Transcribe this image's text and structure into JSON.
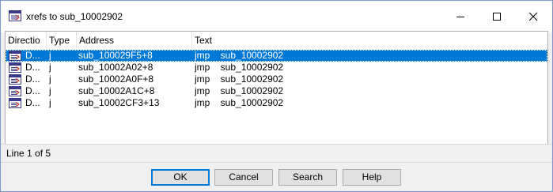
{
  "window": {
    "title": "xrefs to sub_10002902",
    "accent_color": "#0078d7"
  },
  "listview": {
    "columns": [
      "Directio",
      "Type",
      "Address",
      "Text"
    ],
    "rows": [
      {
        "direction": "D...",
        "type": "j",
        "address": "sub_100029F5+8",
        "text": "jmp    sub_10002902",
        "selected": true
      },
      {
        "direction": "D...",
        "type": "j",
        "address": "sub_10002A02+8",
        "text": "jmp    sub_10002902",
        "selected": false
      },
      {
        "direction": "D...",
        "type": "j",
        "address": "sub_10002A0F+8",
        "text": "jmp    sub_10002902",
        "selected": false
      },
      {
        "direction": "D...",
        "type": "j",
        "address": "sub_10002A1C+8",
        "text": "jmp    sub_10002902",
        "selected": false
      },
      {
        "direction": "D...",
        "type": "j",
        "address": "sub_10002CF3+13",
        "text": "jmp    sub_10002902",
        "selected": false
      }
    ]
  },
  "status": {
    "text": "Line 1 of 5"
  },
  "buttons": {
    "ok": "OK",
    "cancel": "Cancel",
    "search": "Search",
    "help": "Help"
  },
  "icons": {
    "title": "xref-window-icon",
    "row": "xref-row-icon",
    "minimize": "minimize-icon",
    "maximize": "maximize-icon",
    "close": "close-icon"
  }
}
